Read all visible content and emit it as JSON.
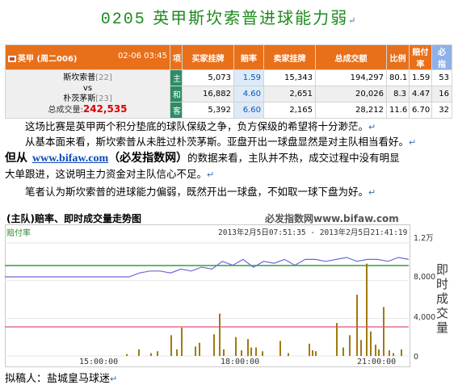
{
  "title_num": "0205",
  "title_text": "英甲斯坎索普进球能力弱",
  "table": {
    "match": "英甲 (周二006)",
    "time": "02-06 03:45",
    "headers": [
      "项",
      "买家挂牌",
      "赔率",
      "卖家挂牌",
      "总成交额",
      "比例",
      "赔付率",
      "必指"
    ],
    "home": "斯坎索普",
    "home_rank": "[22]",
    "vs": "vs",
    "away": "朴茨茅斯",
    "away_rank": "[23]",
    "volume_label": "总成交量:",
    "volume": "242,535",
    "rows": [
      {
        "side": "主",
        "buy": "5,073",
        "odds": "1.59",
        "sell": "15,343",
        "total": "194,297",
        "ratio": "80.1",
        "payout": "1.59",
        "index": "53"
      },
      {
        "side": "和",
        "buy": "16,882",
        "odds": "4.60",
        "sell": "2,651",
        "total": "20,026",
        "ratio": "8.3",
        "payout": "4.47",
        "index": "16"
      },
      {
        "side": "客",
        "buy": "5,392",
        "odds": "6.60",
        "sell": "2,165",
        "total": "28,212",
        "ratio": "11.6",
        "payout": "6.70",
        "index": "32"
      }
    ]
  },
  "p1": "这场比赛是英甲两个积分垫底的球队保级之争，负方保级的希望将十分渺茫。",
  "p2": "从基本面来看，斯坎索普从未胜过朴茨茅斯。亚盘开出一球盘显然是对主队相当看好。",
  "p3_pre": "但从",
  "p3_link": "www.bifaw.com",
  "p3_bold": "（必发指数网）",
  "p3_post": "的数据来看，主队并不热，成交过程中没有明显",
  "p4": "大单跟进，这说明主力资金对主队信心不足。",
  "p5": "笔者认为斯坎索普的进球能力偏弱，既然开出一球盘，不如取一球下盘为好。",
  "chart": {
    "title": "(主队)赔率、即时成交量走势图",
    "watermark": "必发指数网www.bifaw.com",
    "series_label": "赔付率",
    "range": "2013年2月5日07:51:35 - 2013年2月5日21:41:19",
    "y_title": "即时成交量",
    "yticks": [
      "1.2万",
      "8,000",
      "4,000",
      "0"
    ],
    "xticks": [
      "15:00:00",
      "18:00:00",
      "21:00:00"
    ]
  },
  "chart_data": {
    "type": "line",
    "series": [
      {
        "name": "赔付率",
        "color": "#6b6bd6",
        "values": [
          1.5,
          1.5,
          1.5,
          1.5,
          1.5,
          1.5,
          1.5,
          1.5,
          1.5,
          1.5,
          1.5,
          1.5,
          1.5,
          1.52,
          1.53,
          1.53,
          1.52,
          1.54,
          1.53,
          1.55,
          1.54,
          1.58,
          1.56,
          1.59,
          1.55,
          1.58,
          1.57,
          1.59,
          1.56,
          1.59,
          1.59,
          1.58,
          1.59,
          1.6,
          1.58,
          1.59,
          1.59,
          1.58,
          1.6,
          1.59
        ]
      },
      {
        "name": "即时成交量",
        "color": "#a07a10",
        "bars": [
          [
            150,
            200
          ],
          [
            165,
            700
          ],
          [
            180,
            300
          ],
          [
            188,
            500
          ],
          [
            205,
            2200
          ],
          [
            212,
            700
          ],
          [
            218,
            3000
          ],
          [
            235,
            1000
          ],
          [
            240,
            1400
          ],
          [
            258,
            2300
          ],
          [
            265,
            4500
          ],
          [
            270,
            700
          ],
          [
            285,
            2000
          ],
          [
            292,
            600
          ],
          [
            300,
            1800
          ],
          [
            304,
            900
          ],
          [
            310,
            900
          ],
          [
            318,
            500
          ],
          [
            340,
            1600
          ],
          [
            350,
            300
          ],
          [
            376,
            1300
          ],
          [
            380,
            600
          ],
          [
            384,
            500
          ],
          [
            410,
            3500
          ],
          [
            418,
            900
          ],
          [
            426,
            2200
          ],
          [
            435,
            6500
          ],
          [
            440,
            1700
          ],
          [
            447,
            9800
          ],
          [
            452,
            2600
          ],
          [
            458,
            1200
          ],
          [
            462,
            700
          ],
          [
            468,
            5200
          ],
          [
            475,
            600
          ],
          [
            480,
            300
          ],
          [
            490,
            700
          ]
        ]
      }
    ],
    "ylim": [
      0,
      12000
    ]
  }
}
